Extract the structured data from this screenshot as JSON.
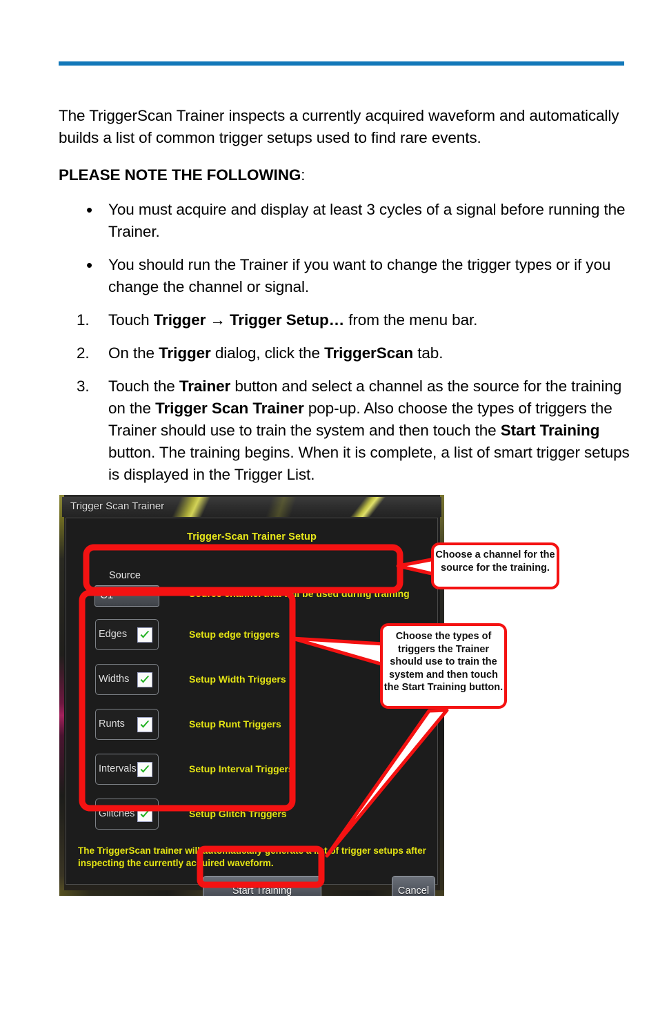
{
  "document": {
    "intro": "The TriggerScan Trainer inspects a currently acquired waveform and automatically builds a list of common trigger setups used to find rare events.",
    "note_heading_bold": "PLEASE NOTE THE FOLLOWING",
    "note_heading_tail": ":",
    "bullets": [
      {
        "marker": "•",
        "text": " You must acquire and display at least 3 cycles of a signal before running the Trainer."
      },
      {
        "marker": "•",
        "text": "You should run the Trainer if you want to change the trigger types or if you change the channel or signal."
      }
    ],
    "steps": [
      {
        "marker": "1.",
        "segments": [
          {
            "text": "Touch ",
            "bold": false
          },
          {
            "text": "Trigger → Trigger Setup…",
            "bold": true
          },
          {
            "text": " from the menu bar.",
            "bold": false
          }
        ]
      },
      {
        "marker": "2.",
        "segments": [
          {
            "text": "On the ",
            "bold": false
          },
          {
            "text": "Trigger",
            "bold": true
          },
          {
            "text": " dialog, click the ",
            "bold": false
          },
          {
            "text": "TriggerScan",
            "bold": true
          },
          {
            "text": " tab.",
            "bold": false
          }
        ]
      },
      {
        "marker": "3.",
        "segments": [
          {
            "text": "Touch the ",
            "bold": false
          },
          {
            "text": "Trainer",
            "bold": true
          },
          {
            "text": " button and select a channel as the source for the training on the ",
            "bold": false
          },
          {
            "text": "Trigger Scan Trainer",
            "bold": true
          },
          {
            "text": " pop-up. Also choose the types of triggers the Trainer should use to train the system and then touch the ",
            "bold": false
          },
          {
            "text": "Start Training",
            "bold": true
          },
          {
            "text": " button. The training begins. When it is complete, a list of smart trigger setups is displayed in the Trigger List.",
            "bold": false
          }
        ]
      }
    ]
  },
  "screenshot": {
    "window_title": "Trigger Scan Trainer",
    "dialog": {
      "heading": "Trigger-Scan Trainer Setup",
      "source": {
        "label": "Source",
        "value": "C1",
        "hint": "Source channel that will be used during training"
      },
      "checkboxes": [
        {
          "label": "Edges",
          "checked": true,
          "hint": "Setup edge triggers"
        },
        {
          "label": "Widths",
          "checked": true,
          "hint": "Setup Width Triggers"
        },
        {
          "label": "Runts",
          "checked": true,
          "hint": "Setup Runt Triggers"
        },
        {
          "label": "Intervals",
          "checked": true,
          "hint": "Setup Interval Triggers"
        },
        {
          "label": "Glitches",
          "checked": true,
          "hint": "Setup Glitch Triggers"
        }
      ],
      "footer_note": "The TriggerScan trainer will automatically generate a list of trigger setups after inspecting the currently acquired waveform.",
      "buttons": {
        "start": "Start Training",
        "cancel": "Cancel"
      }
    },
    "callouts": [
      {
        "text": "Choose a channel for the source for the training."
      },
      {
        "text": "Choose the types of triggers the Trainer should use to train the system and then touch the Start Training button."
      }
    ]
  },
  "colors": {
    "rule_blue": "#1278b9",
    "annotation_red": "#f41212",
    "dialog_yellow_text": "#e4e414",
    "dialog_background": "#1c1c1c",
    "checkbox_tick_green": "#22b022"
  }
}
